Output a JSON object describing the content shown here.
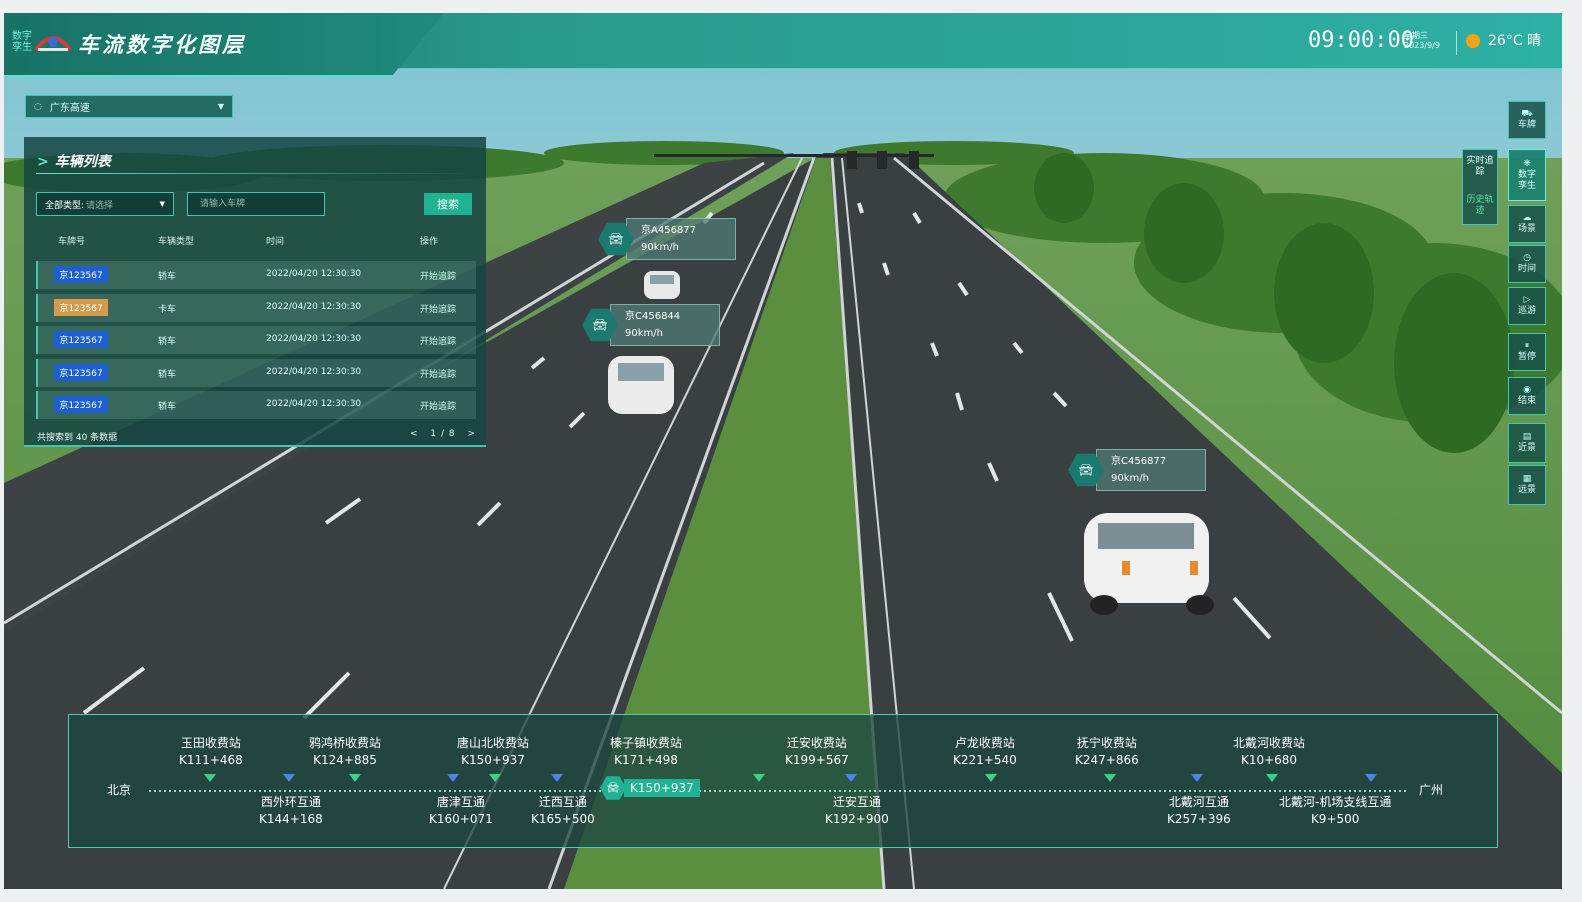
{
  "app": {
    "logo_sub": "数字孪生",
    "title": "车流数字化图层",
    "time": "09:00:00",
    "weekday": "星期三",
    "date": "2023/9/9",
    "weather": "26°C 晴",
    "region": "广东高速"
  },
  "panel": {
    "title": "车辆列表",
    "type_label": "全部类型:",
    "type_placeholder": "请选择",
    "plate_placeholder": "请输入车牌",
    "search_label": "搜索",
    "headers": [
      "车牌号",
      "车辆类型",
      "时间",
      "操作"
    ],
    "rows": [
      {
        "plate": "京123567",
        "color": "blue",
        "type": "轿车",
        "time": "2022/04/20 12:30:30",
        "action": "开始追踪"
      },
      {
        "plate": "京123567",
        "color": "yellow",
        "type": "卡车",
        "time": "2022/04/20 12:30:30",
        "action": "开始追踪"
      },
      {
        "plate": "京123567",
        "color": "blue",
        "type": "轿车",
        "time": "2022/04/20 12:30:30",
        "action": "开始追踪"
      },
      {
        "plate": "京123567",
        "color": "blue",
        "type": "轿车",
        "time": "2022/04/20 12:30:30",
        "action": "开始追踪"
      },
      {
        "plate": "京123567",
        "color": "blue",
        "type": "轿车",
        "time": "2022/04/20 12:30:30",
        "action": "开始追踪"
      }
    ],
    "footer": "共搜索到 40 条数据",
    "page": "1 / 8"
  },
  "vehicles": [
    {
      "plate": "京A456877",
      "speed": "90km/h"
    },
    {
      "plate": "京C456844",
      "speed": "90km/h"
    },
    {
      "plate": "京C456877",
      "speed": "90km/h"
    }
  ],
  "right_tools": [
    {
      "name": "plate",
      "icon": "car-icon",
      "label": "车牌",
      "active": false
    },
    {
      "name": "twin",
      "icon": "twin-icon",
      "label": "数字孪生",
      "active": true
    },
    {
      "name": "scene",
      "icon": "cloud-icon",
      "label": "场景",
      "active": false
    },
    {
      "name": "time",
      "icon": "clock-icon",
      "label": "时间",
      "active": false
    },
    {
      "name": "patrol",
      "icon": "play-icon",
      "label": "巡游",
      "active": false
    },
    {
      "name": "pause",
      "icon": "pause-icon",
      "label": "暂停",
      "active": false
    },
    {
      "name": "end",
      "icon": "stop-icon",
      "label": "结束",
      "active": false
    },
    {
      "name": "near",
      "icon": "near-view-icon",
      "label": "近景",
      "active": false
    },
    {
      "name": "far",
      "icon": "far-view-icon",
      "label": "远景",
      "active": false
    }
  ],
  "sub_tools": {
    "realtime": "实时追踪",
    "history": "历史轨迹"
  },
  "timeline": {
    "start": "北京",
    "end": "广州",
    "current": "K150+937",
    "top_stations": [
      {
        "name": "玉田收费站",
        "km": "K111+468",
        "marker": "green"
      },
      {
        "name": "鸦鸿桥收费站",
        "km": "K124+885",
        "marker": "green"
      },
      {
        "name": "唐山北收费站",
        "km": "K150+937",
        "marker": "green"
      },
      {
        "name": "榛子镇收费站",
        "km": "K171+498",
        "marker": "green"
      },
      {
        "name": "迁安收费站",
        "km": "K199+567",
        "marker": "green"
      },
      {
        "name": "卢龙收费站",
        "km": "K221+540",
        "marker": "green"
      },
      {
        "name": "抚宁收费站",
        "km": "K247+866",
        "marker": "green"
      },
      {
        "name": "北戴河收费站",
        "km": "K10+680",
        "marker": "green"
      }
    ],
    "bottom_stations": [
      {
        "name": "西外环互通",
        "km": "K144+168",
        "marker": "blue"
      },
      {
        "name": "唐津互通",
        "km": "K160+071",
        "marker": "blue"
      },
      {
        "name": "迁西互通",
        "km": "K165+500",
        "marker": "blue"
      },
      {
        "name": "迁安互通",
        "km": "K192+900",
        "marker": "blue"
      },
      {
        "name": "北戴河互通",
        "km": "K257+396",
        "marker": "blue"
      },
      {
        "name": "北戴河-机场支线互通",
        "km": "K9+500",
        "marker": "blue"
      }
    ]
  }
}
